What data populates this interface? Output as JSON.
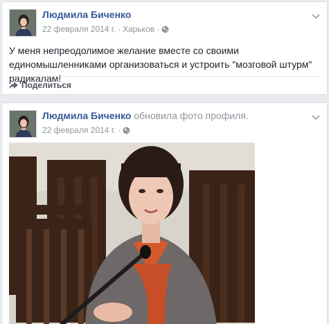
{
  "posts": [
    {
      "author": "Людмила Биченко",
      "date": "22 февраля 2014 г.",
      "separator": "·",
      "location": "Харьков",
      "privacy_icon": "globe-icon",
      "text": "У меня непреодолимое желание вместе со своими единомышленниками организоваться и устроить \"мозговой штурм\" радикалам!",
      "share_label": "Поделиться",
      "share_icon": "share-arrow-icon",
      "menu_icon": "chevron-down-icon"
    },
    {
      "author": "Людмила Биченко",
      "action": "обновила фото профиля.",
      "date": "22 февраля 2014 г.",
      "separator": "·",
      "privacy_icon": "globe-icon",
      "menu_icon": "chevron-down-icon"
    }
  ],
  "colors": {
    "link": "#365899",
    "meta": "#90949c",
    "text": "#1d2129",
    "background": "#e9ebee"
  }
}
